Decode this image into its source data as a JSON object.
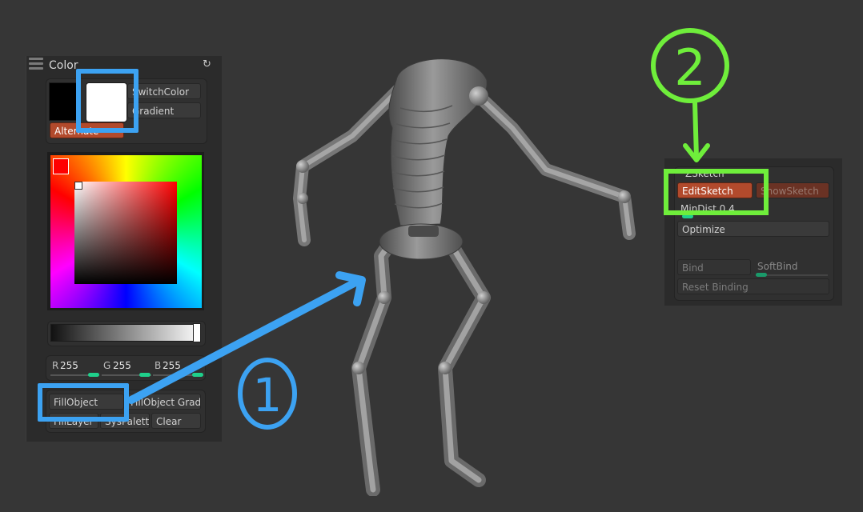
{
  "color_panel": {
    "title": "Color",
    "refresh_icon": "refresh-icon",
    "buttons": {
      "switch_color": "SwitchColor",
      "gradient": "Gradient",
      "alternate": "Alternate",
      "fill_object": "FillObject",
      "fill_object_grad": "FillObject Grad",
      "fill_layer": "FillLayer",
      "sys_palette": "SysPalette",
      "clear": "Clear"
    },
    "primary_color": "#000000",
    "secondary_color": "#ffffff",
    "rgb": {
      "r_label": "R",
      "r_value": "255",
      "g_label": "G",
      "g_value": "255",
      "b_label": "B",
      "b_value": "255"
    },
    "gray_level": 1.0
  },
  "sketch_panel": {
    "title": "ZSketch",
    "buttons": {
      "edit_sketch": "EditSketch",
      "show_sketch": "ShowSketch",
      "optimize": "Optimize",
      "bind": "Bind",
      "soft_bind": "SoftBind",
      "reset_binding": "Reset Binding"
    },
    "min_dist_label": "MinDist 0.4"
  },
  "annotations": {
    "step1": "1",
    "step2": "2",
    "colors": {
      "blue": "#3ca2f2",
      "green": "#6fee3b",
      "accent": "#b24a2c"
    }
  }
}
